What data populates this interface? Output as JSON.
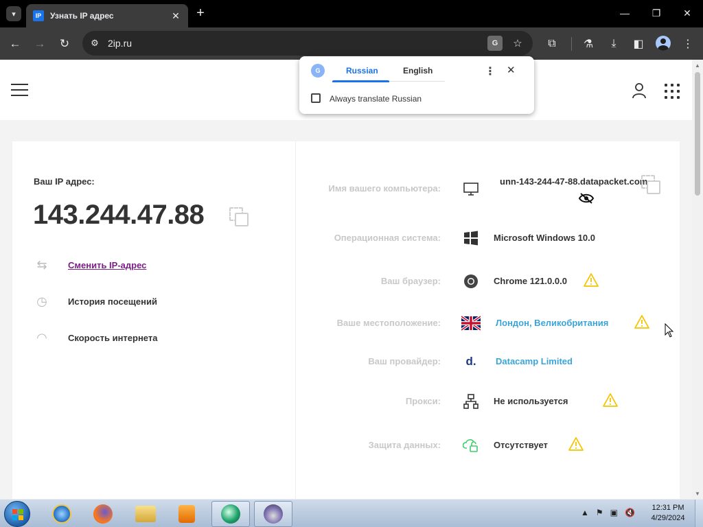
{
  "browser": {
    "tab_search_icon": "chevron-down-icon",
    "tab": {
      "favicon_text": "IP",
      "title": "Узнать IP адрес",
      "close": "✕"
    },
    "new_tab": "+",
    "window_controls": {
      "minimize": "—",
      "maximize": "❐",
      "close": "✕"
    },
    "nav": {
      "back": "←",
      "forward": "→",
      "reload": "↻"
    },
    "omnibox": {
      "site_info": "⚙",
      "url": "2ip.ru",
      "translate_icon": "G",
      "bookmark_icon": "☆"
    },
    "toolbar_icons": {
      "extensions": "⧉",
      "labs": "⚗",
      "downloads": "⤓",
      "sidepanel": "◧",
      "menu": "⋮"
    }
  },
  "translate_popup": {
    "logo": "G",
    "source_language": "Russian",
    "target_language": "English",
    "more": "⋮",
    "close": "✕",
    "always_translate_label": "Always translate Russian",
    "always_translate_checked": false
  },
  "site": {
    "ip_label": "Ваш IP адрес:",
    "ip_value": "143.244.47.88",
    "side_links": [
      {
        "label": "Сменить IP-адрес",
        "icon": "switch-ip-icon"
      },
      {
        "label": "История посещений",
        "icon": "history-icon"
      },
      {
        "label": "Скорость интернета",
        "icon": "speedometer-icon"
      }
    ],
    "info": [
      {
        "label": "Имя вашего компьютера:",
        "value": "unn-143-244-47-88.datapacket.com",
        "icon": "monitor-icon",
        "warning": false
      },
      {
        "label": "Операционная система:",
        "value": "Microsoft Windows 10.0",
        "icon": "windows-icon",
        "warning": false
      },
      {
        "label": "Ваш браузер:",
        "value": "Chrome 121.0.0.0",
        "icon": "chrome-icon",
        "warning": true
      },
      {
        "label": "Ваше местоположение:",
        "value": "Лондон, Великобритания",
        "icon": "uk-flag-icon",
        "warning": true
      },
      {
        "label": "Ваш провайдер:",
        "value": "Datacamp Limited",
        "icon": "provider-logo-icon",
        "provider_logo_text": "d.",
        "warning": false
      },
      {
        "label": "Прокси:",
        "value": "Не используется",
        "icon": "proxy-network-icon",
        "warning": true
      },
      {
        "label": "Защита данных:",
        "value": "Отсутствует",
        "icon": "unlock-cloud-icon",
        "warning": true
      }
    ]
  },
  "taskbar": {
    "apps": [
      "ie-icon",
      "firefox-icon",
      "explorer-icon",
      "media-player-icon",
      "app-icon-1",
      "app-icon-2"
    ],
    "tray_icons": [
      "▲",
      "⚑",
      "▣",
      "🔇"
    ],
    "time": "12:31 PM",
    "date": "4/29/2024"
  },
  "colors": {
    "accent_link": "#7b1f86",
    "value_blue": "#3aa4d8",
    "warning": "#f2c500",
    "chrome_blue": "#1a73e8"
  }
}
